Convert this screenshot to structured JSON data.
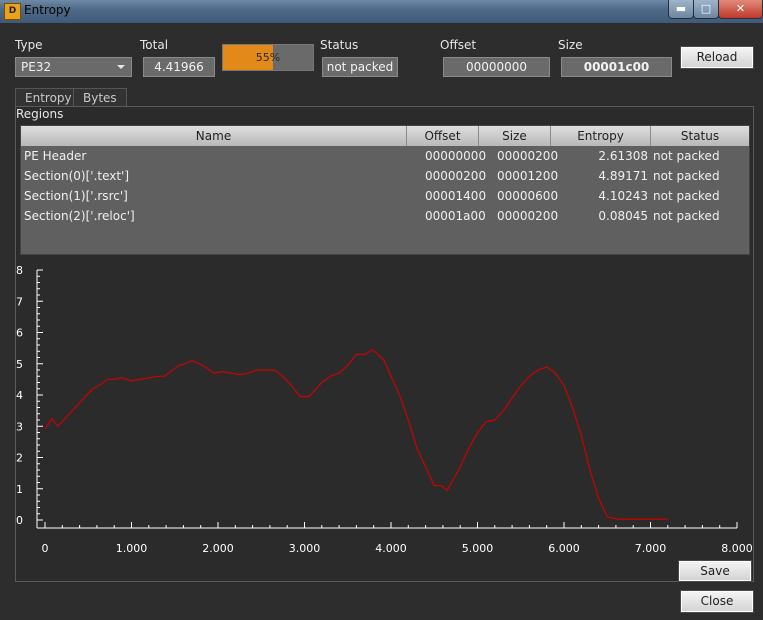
{
  "window": {
    "title": "Entropy",
    "app_icon": "die-icon"
  },
  "header": {
    "type_label": "Type",
    "type_value": "PE32",
    "total_label": "Total",
    "total_value": "4.41966",
    "progress_text": "55%",
    "progress_fraction": 0.55,
    "status_label": "Status",
    "status_value": "not packed",
    "offset_label": "Offset",
    "offset_value": "00000000",
    "size_label": "Size",
    "size_value": "00001c00",
    "reload_label": "Reload"
  },
  "tabs": [
    {
      "label": "Entropy"
    },
    {
      "label": "Bytes"
    }
  ],
  "regions": {
    "label": "Regions",
    "columns": [
      "Name",
      "Offset",
      "Size",
      "Entropy",
      "Status"
    ],
    "rows": [
      {
        "name": "PE Header",
        "offset": "00000000",
        "size": "00000200",
        "entropy": "2.61308",
        "status": "not packed"
      },
      {
        "name": "Section(0)['.text']",
        "offset": "00000200",
        "size": "00001200",
        "entropy": "4.89171",
        "status": "not packed"
      },
      {
        "name": "Section(1)['.rsrc']",
        "offset": "00001400",
        "size": "00000600",
        "entropy": "4.10243",
        "status": "not packed"
      },
      {
        "name": "Section(2)['.reloc']",
        "offset": "00001a00",
        "size": "00000200",
        "entropy": "0.08045",
        "status": "not packed"
      }
    ]
  },
  "chart_data": {
    "type": "line",
    "xlim": [
      0,
      8
    ],
    "ylim": [
      0,
      8
    ],
    "x_ticks": [
      "0",
      "1.000",
      "2.000",
      "3.000",
      "4.000",
      "5.000",
      "6.000",
      "7.000",
      "8.000"
    ],
    "y_ticks": [
      "0",
      "1",
      "2",
      "3",
      "4",
      "5",
      "6",
      "7",
      "8"
    ],
    "line_color": "#cc0000",
    "grid": false,
    "series": [
      {
        "x": [
          0.0,
          0.08,
          0.15,
          0.25,
          0.35,
          0.45,
          0.55,
          0.65,
          0.72,
          0.8,
          0.88,
          0.95,
          1.0,
          1.1,
          1.2,
          1.3,
          1.38,
          1.45,
          1.55,
          1.62,
          1.7,
          1.78,
          1.85,
          1.95,
          2.05,
          2.15,
          2.25,
          2.35,
          2.45,
          2.55,
          2.65,
          2.75,
          2.85,
          2.95,
          3.05,
          3.12,
          3.2,
          3.3,
          3.4,
          3.5,
          3.6,
          3.7,
          3.78,
          3.85,
          3.92,
          4.0,
          4.1,
          4.2,
          4.3,
          4.4,
          4.5,
          4.58,
          4.65,
          4.7,
          4.8,
          4.9,
          5.0,
          5.1,
          5.2,
          5.3,
          5.4,
          5.5,
          5.6,
          5.7,
          5.8,
          5.9,
          6.0,
          6.1,
          6.2,
          6.3,
          6.4,
          6.5,
          6.58,
          6.62,
          6.7,
          6.8,
          6.9,
          7.0,
          7.1,
          7.2
        ],
        "y": [
          2.9,
          3.25,
          3.0,
          3.3,
          3.6,
          3.9,
          4.2,
          4.35,
          4.5,
          4.5,
          4.55,
          4.5,
          4.45,
          4.5,
          4.55,
          4.6,
          4.6,
          4.75,
          4.95,
          5.0,
          5.1,
          5.0,
          4.9,
          4.7,
          4.75,
          4.7,
          4.65,
          4.7,
          4.8,
          4.8,
          4.8,
          4.6,
          4.3,
          3.95,
          3.95,
          4.15,
          4.4,
          4.6,
          4.7,
          4.95,
          5.3,
          5.3,
          5.45,
          5.3,
          5.1,
          4.6,
          4.0,
          3.2,
          2.3,
          1.7,
          1.1,
          1.1,
          0.95,
          1.2,
          1.7,
          2.3,
          2.8,
          3.15,
          3.2,
          3.5,
          3.9,
          4.3,
          4.6,
          4.8,
          4.9,
          4.7,
          4.3,
          3.6,
          2.7,
          1.6,
          0.7,
          0.1,
          0.05,
          0.03,
          0.03,
          0.03,
          0.03,
          0.03,
          0.03,
          0.03
        ]
      }
    ]
  },
  "footer": {
    "save_label": "Save",
    "close_label": "Close"
  }
}
